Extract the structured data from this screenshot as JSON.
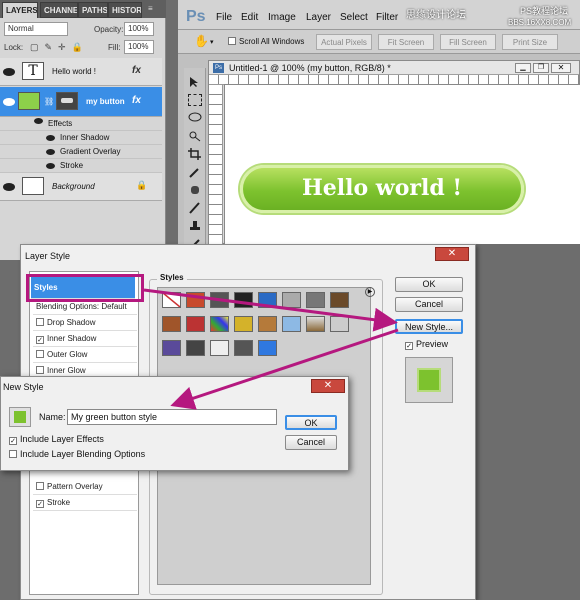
{
  "layers_panel": {
    "tabs": [
      "LAYERS",
      "CHANNE",
      "PATHS",
      "HISTOR"
    ],
    "blend_mode": "Normal",
    "opacity_label": "Opacity:",
    "opacity_value": "100%",
    "lock_label": "Lock:",
    "fill_label": "Fill:",
    "fill_value": "100%",
    "layers": [
      {
        "name": "Hello world !",
        "fx": "fx"
      },
      {
        "name": "my button",
        "fx": "fx"
      },
      {
        "name": "Background"
      }
    ],
    "effects_label": "Effects",
    "effects": [
      "Inner Shadow",
      "Gradient Overlay",
      "Stroke"
    ]
  },
  "app": {
    "logo": "Ps",
    "menu": [
      "File",
      "Edit",
      "Image",
      "Layer",
      "Select",
      "Filter"
    ],
    "options": {
      "scroll_all_windows": "Scroll All Windows",
      "buttons": [
        "Actual Pixels",
        "Fit Screen",
        "Fill Screen",
        "Print Size"
      ]
    },
    "doc_title": "Untitled-1 @ 100% (my button, RGB/8) *",
    "canvas_text": "Hello world !"
  },
  "layer_style": {
    "title": "Layer Style",
    "left_items": [
      "Styles",
      "Blending Options: Default",
      "Drop Shadow",
      "Inner Shadow",
      "Outer Glow",
      "Inner Glow",
      "Pattern Overlay",
      "Stroke"
    ],
    "checked": [
      "Inner Shadow",
      "Stroke"
    ],
    "styles_label": "Styles",
    "ok": "OK",
    "cancel": "Cancel",
    "new_style": "New Style...",
    "preview": "Preview"
  },
  "new_style_dialog": {
    "title": "New Style",
    "name_label": "Name:",
    "name_value": "My green button style",
    "include_effects": "Include Layer Effects",
    "include_blending": "Include Layer Blending Options",
    "ok": "OK",
    "cancel": "Cancel"
  },
  "colors": {
    "accent_magenta": "#b5187f",
    "green": "#7dc22e",
    "selection_blue": "#3a8ee6"
  },
  "watermark": {
    "line1": "思缘设计论坛",
    "line2": "PS教程论坛",
    "line3": "BBS.16XX8.COM"
  }
}
